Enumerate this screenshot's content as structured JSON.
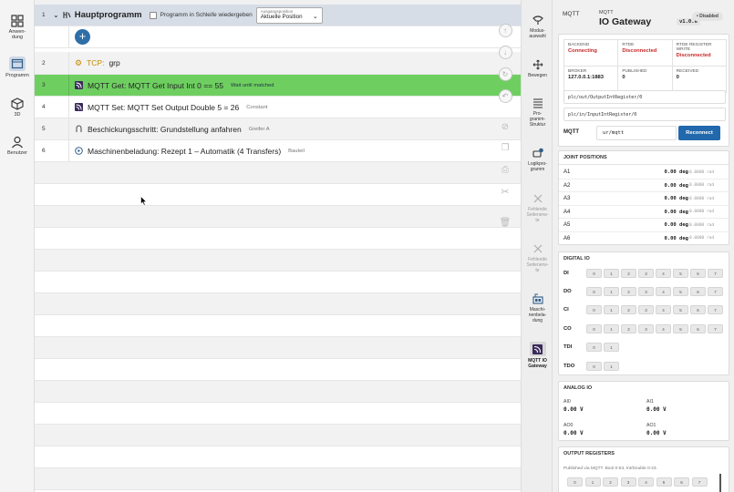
{
  "left_nav": [
    {
      "label": "Anwen-\ndung",
      "icon": "apps-grid-icon"
    },
    {
      "label": "Programm",
      "icon": "program-window-icon",
      "active": true
    },
    {
      "label": "3D",
      "icon": "cube-3d-icon"
    },
    {
      "label": "Benutzer",
      "icon": "user-icon"
    }
  ],
  "tree": {
    "header": {
      "num": "1",
      "title": "Hauptprogramm",
      "loop_label": "Programm in Schleife wiedergeben",
      "start_placeholder": "Ausgangsposition",
      "start_value": "Aktuelle Position"
    },
    "rows": [
      {
        "num": "2",
        "prefix": "TCP:",
        "text": "grp",
        "hint": "",
        "icon": "tcp-icon"
      },
      {
        "num": "3",
        "prefix": "",
        "text": "MQTT Get:  MQTT Get Input Int 0 == 55",
        "hint": "Wait until matched",
        "icon": "mqtt-icon"
      },
      {
        "num": "4",
        "prefix": "",
        "text": "MQTT Set:  MQTT Set Output Double 5 = 26",
        "hint": "Constant",
        "icon": "mqtt-icon"
      },
      {
        "num": "5",
        "prefix": "",
        "text": "Beschickungsschritt:  Grundstellung anfahren",
        "hint": "Greifer A",
        "icon": "gripper-icon"
      },
      {
        "num": "6",
        "prefix": "",
        "text": "Maschinenbeladung:  Rezept 1 – Automatik (4 Transfers)",
        "hint": "Bauteil",
        "icon": "play-circle-icon"
      }
    ]
  },
  "right_nav": [
    {
      "label": "Modus-\nauswahl",
      "icon": "mode-select-icon"
    },
    {
      "label": "Bewegen",
      "icon": "move-arrows-icon"
    },
    {
      "label": "Pro-\ngramm-\nStruktur",
      "icon": "list-structure-icon"
    },
    {
      "label": "Logikpro-\ngramm",
      "icon": "logic-program-icon"
    },
    {
      "label": "Fehlende\nSeitenerw-\nte",
      "icon": "close-icon",
      "disabled": true
    },
    {
      "label": "Fehlende\nSeitenerw-\nte",
      "icon": "close-icon",
      "disabled": true
    },
    {
      "label": "Maschi-\nnenbela-\ndung",
      "icon": "machine-loading-icon"
    },
    {
      "label": "MQTT IO\nGateway",
      "icon": "mqtt-gateway-icon",
      "active": true
    }
  ],
  "panel": {
    "mqtt_label": "MQTT",
    "subtitle": "MQTT",
    "title": "IO Gateway",
    "version": "v1.0.6",
    "status_badge": "• Disabled",
    "stats": [
      {
        "k": "BACKEND",
        "v": "Connecting",
        "red": true
      },
      {
        "k": "RTDE",
        "v": "Disconnected",
        "red": true
      },
      {
        "k": "RTDE REGISTER WRITE",
        "v": "Disconnected",
        "red": true
      },
      {
        "k": "BROKER",
        "v": "127.0.0.1:1883",
        "red": false
      },
      {
        "k": "PUBLISHED",
        "v": "0",
        "red": false
      },
      {
        "k": "RECEIVED",
        "v": "0",
        "red": false
      }
    ],
    "topic_out": "plc/out/OutputIntRegister/0",
    "topic_in": "plc/in/InputIntRegister/0",
    "mqtt_field_label": "MQTT",
    "mqtt_prefix": "ur/mqtt",
    "reconnect_label": "Reconnect",
    "joint_title": "JOINT POSITIONS",
    "joints": [
      {
        "n": "A1",
        "deg": "0.00 deg",
        "rad": "0.0000 rad"
      },
      {
        "n": "A2",
        "deg": "0.00 deg",
        "rad": "0.0000 rad"
      },
      {
        "n": "A3",
        "deg": "0.00 deg",
        "rad": "0.0000 rad"
      },
      {
        "n": "A4",
        "deg": "0.00 deg",
        "rad": "0.0000 rad"
      },
      {
        "n": "A5",
        "deg": "0.00 deg",
        "rad": "0.0000 rad"
      },
      {
        "n": "A6",
        "deg": "0.00 deg",
        "rad": "0.0000 rad"
      }
    ],
    "digital_title": "DIGITAL IO",
    "digital": [
      {
        "n": "DI",
        "bits": [
          "0",
          "1",
          "2",
          "3",
          "4",
          "5",
          "6",
          "7"
        ]
      },
      {
        "n": "DO",
        "bits": [
          "0",
          "1",
          "2",
          "3",
          "4",
          "5",
          "6",
          "7"
        ]
      },
      {
        "n": "CI",
        "bits": [
          "0",
          "1",
          "2",
          "3",
          "4",
          "5",
          "6",
          "7"
        ]
      },
      {
        "n": "CO",
        "bits": [
          "0",
          "1",
          "2",
          "3",
          "4",
          "5",
          "6",
          "7"
        ]
      },
      {
        "n": "TDI",
        "bits": [
          "0",
          "1"
        ]
      },
      {
        "n": "TDO",
        "bits": [
          "0",
          "1"
        ]
      }
    ],
    "analog_title": "ANALOG IO",
    "analog": [
      {
        "n": "AI0",
        "v": "0.00 V"
      },
      {
        "n": "AI1",
        "v": "0.00 V"
      },
      {
        "n": "AO0",
        "v": "0.00 V"
      },
      {
        "n": "AO1",
        "v": "0.00 V"
      }
    ],
    "output_title": "OUTPUT REGISTERS",
    "output_note": "Published via MQTT. Bool 0-63, Int/Double 0-23.",
    "output_bits": [
      "0",
      "1",
      "2",
      "3",
      "4",
      "5",
      "6",
      "7"
    ]
  }
}
